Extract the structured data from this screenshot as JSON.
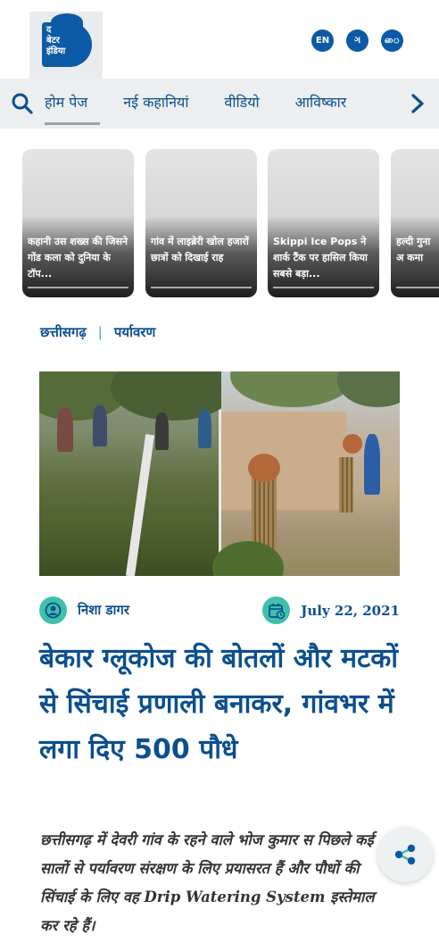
{
  "header": {
    "logo_lines": [
      "द",
      "बेटर",
      "इंडिया"
    ],
    "languages": [
      "EN",
      "ગ",
      "ை"
    ]
  },
  "nav": {
    "items": [
      "होम पेज",
      "नई कहानियां",
      "वीडियो",
      "आविष्कार"
    ],
    "active_index": 0
  },
  "stories": [
    {
      "text": "कहानी उस शख्स की जिसने गोंड कला को दुनिया के टॉप..."
    },
    {
      "text": "गांव में लाइब्रेरी खोल हजारों छात्रों को दिखाई राह"
    },
    {
      "text": "Skippi Ice Pops ने शार्क टैंक पर हासिल किया सबसे बड़ा..."
    },
    {
      "text": "हल्दी गुना अ कमा"
    }
  ],
  "article": {
    "categories": [
      "छत्तीसगढ़",
      "पर्यावरण"
    ],
    "category_separator": "|",
    "author": "निशा डागर",
    "date": "July 22, 2021",
    "title": "बेकार ग्लूकोज की बोतलों और मटकों से सिंचाई प्रणाली बनाकर, गांवभर में लगा दिए 500 पौधे",
    "excerpt": "छत्तीसगढ़ में देवरी गांव के रहने वाले भोज कुमार स पिछले कई सालों से पर्यावरण संरक्षण के लिए प्रयासरत हैं और पौधों की सिंचाई के लिए वह Drip Watering System इस्तेमाल कर रहे हैं।"
  },
  "colors": {
    "brand_blue": "#0c5aa6",
    "accent_teal": "#3fc0a8",
    "nav_bg": "#eceeef"
  },
  "icons": [
    "search-icon",
    "chevron-right-icon",
    "user-icon",
    "calendar-icon",
    "share-icon"
  ]
}
